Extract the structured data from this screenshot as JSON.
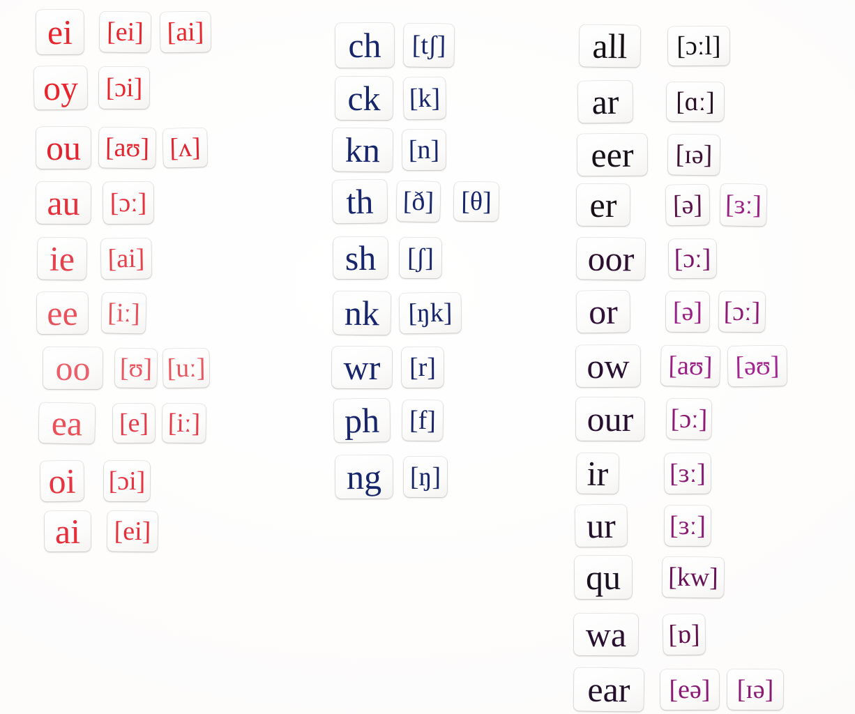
{
  "board": {
    "background_color": "#fdfcfb",
    "tile_color": "#fefefe",
    "description": "Phonics magnet tiles: grapheme spellings paired with IPA phoneme tiles, arranged in three columns"
  },
  "palette": {
    "vowel_red": "#e8242c",
    "vowel_red_light": "#e8555c",
    "vowel_pink": "#ea5a66",
    "consonant_navy": "#17256b",
    "r_controlled_black": "#1b1018",
    "r_controlled_purple": "#5a1048",
    "r_controlled_magenta": "#9b1f84"
  },
  "columns": [
    {
      "name": "vowel-digraphs",
      "rows": [
        {
          "grapheme": "ei",
          "grapheme_color": "#e8242c",
          "phonemes": [
            {
              "text": "[ei]",
              "color": "#e8242c"
            },
            {
              "text": "[ai]",
              "color": "#e8242c"
            }
          ]
        },
        {
          "grapheme": "oy",
          "grapheme_color": "#e8242c",
          "phonemes": [
            {
              "text": "[ɔi]",
              "color": "#e8242c"
            }
          ]
        },
        {
          "grapheme": "ou",
          "grapheme_color": "#e02530",
          "phonemes": [
            {
              "text": "[aʊ]",
              "color": "#e02530"
            },
            {
              "text": "[ʌ]",
              "color": "#e02530"
            }
          ]
        },
        {
          "grapheme": "au",
          "grapheme_color": "#e4313c",
          "phonemes": [
            {
              "text": "[ɔː]",
              "color": "#e4313c"
            }
          ]
        },
        {
          "grapheme": "ie",
          "grapheme_color": "#e5414c",
          "phonemes": [
            {
              "text": "[ai]",
              "color": "#e5414c"
            }
          ]
        },
        {
          "grapheme": "ee",
          "grapheme_color": "#e8525c",
          "phonemes": [
            {
              "text": "[iː]",
              "color": "#e8525c"
            }
          ]
        },
        {
          "grapheme": "oo",
          "grapheme_color": "#ea5f6a",
          "phonemes": [
            {
              "text": "[ʊ]",
              "color": "#e8555f"
            },
            {
              "text": "[uː]",
              "color": "#e8555f"
            }
          ]
        },
        {
          "grapheme": "ea",
          "grapheme_color": "#e8505a",
          "phonemes": [
            {
              "text": "[e]",
              "color": "#e23c48"
            },
            {
              "text": "[iː]",
              "color": "#e23c48"
            }
          ]
        },
        {
          "grapheme": "oi",
          "grapheme_color": "#e63541",
          "phonemes": [
            {
              "text": "[ɔi]",
              "color": "#e63541"
            }
          ]
        },
        {
          "grapheme": "ai",
          "grapheme_color": "#e4303b",
          "phonemes": [
            {
              "text": "[ei]",
              "color": "#e4303b"
            }
          ]
        }
      ]
    },
    {
      "name": "consonant-digraphs",
      "rows": [
        {
          "grapheme": "ch",
          "grapheme_color": "#17256b",
          "phonemes": [
            {
              "text": "[tʃ]",
              "color": "#17256b"
            }
          ]
        },
        {
          "grapheme": "ck",
          "grapheme_color": "#17256b",
          "phonemes": [
            {
              "text": "[k]",
              "color": "#17256b"
            }
          ]
        },
        {
          "grapheme": "kn",
          "grapheme_color": "#17256b",
          "phonemes": [
            {
              "text": "[n]",
              "color": "#17256b"
            }
          ]
        },
        {
          "grapheme": "th",
          "grapheme_color": "#17256b",
          "phonemes": [
            {
              "text": "[ð]",
              "color": "#17256b"
            },
            {
              "text": "[θ]",
              "color": "#17256b"
            }
          ]
        },
        {
          "grapheme": "sh",
          "grapheme_color": "#17256b",
          "phonemes": [
            {
              "text": "[ʃ]",
              "color": "#17256b"
            }
          ]
        },
        {
          "grapheme": "nk",
          "grapheme_color": "#17256b",
          "phonemes": [
            {
              "text": "[ŋk]",
              "color": "#17256b"
            }
          ]
        },
        {
          "grapheme": "wr",
          "grapheme_color": "#17256b",
          "phonemes": [
            {
              "text": "[r]",
              "color": "#17256b"
            }
          ]
        },
        {
          "grapheme": "ph",
          "grapheme_color": "#17256b",
          "phonemes": [
            {
              "text": "[f]",
              "color": "#17256b"
            }
          ]
        },
        {
          "grapheme": "ng",
          "grapheme_color": "#17256b",
          "phonemes": [
            {
              "text": "[ŋ]",
              "color": "#17256b"
            }
          ]
        }
      ]
    },
    {
      "name": "r-controlled-and-other",
      "rows": [
        {
          "grapheme": "all",
          "grapheme_color": "#141014",
          "phonemes": [
            {
              "text": "[ɔːl]",
              "color": "#141014"
            }
          ]
        },
        {
          "grapheme": "ar",
          "grapheme_color": "#15101a",
          "phonemes": [
            {
              "text": "[ɑː]",
              "color": "#2a1024"
            }
          ]
        },
        {
          "grapheme": "eer",
          "grapheme_color": "#171018",
          "phonemes": [
            {
              "text": "[ɪə]",
              "color": "#3e1036"
            }
          ]
        },
        {
          "grapheme": "er",
          "grapheme_color": "#181016",
          "phonemes": [
            {
              "text": "[ə]",
              "color": "#5a1048"
            },
            {
              "text": "[ɜː]",
              "color": "#9b1f84"
            }
          ]
        },
        {
          "grapheme": "oor",
          "grapheme_color": "#2d1030",
          "phonemes": [
            {
              "text": "[ɔː]",
              "color": "#7d1268"
            }
          ]
        },
        {
          "grapheme": "or",
          "grapheme_color": "#33103a",
          "phonemes": [
            {
              "text": "[ə]",
              "color": "#9b1f84"
            },
            {
              "text": "[ɔː]",
              "color": "#8e1a78"
            }
          ]
        },
        {
          "grapheme": "ow",
          "grapheme_color": "#2a1030",
          "phonemes": [
            {
              "text": "[aʊ]",
              "color": "#9b1f84"
            },
            {
              "text": "[əʊ]",
              "color": "#a42490"
            }
          ]
        },
        {
          "grapheme": "our",
          "grapheme_color": "#2a1030",
          "phonemes": [
            {
              "text": "[ɔː]",
              "color": "#8e1a78"
            }
          ]
        },
        {
          "grapheme": "ir",
          "grapheme_color": "#1d1020",
          "phonemes": [
            {
              "text": "[ɜː]",
              "color": "#8a1a74"
            }
          ]
        },
        {
          "grapheme": "ur",
          "grapheme_color": "#22102a",
          "phonemes": [
            {
              "text": "[ɜː]",
              "color": "#8a1a74"
            }
          ]
        },
        {
          "grapheme": "qu",
          "grapheme_color": "#1a1020",
          "phonemes": [
            {
              "text": "[kw]",
              "color": "#6a1258"
            }
          ]
        },
        {
          "grapheme": "wa",
          "grapheme_color": "#2a1030",
          "phonemes": [
            {
              "text": "[ɒ]",
              "color": "#62104e"
            }
          ]
        },
        {
          "grapheme": "ear",
          "grapheme_color": "#22102a",
          "phonemes": [
            {
              "text": "[eə]",
              "color": "#8a1a74"
            },
            {
              "text": "[ɪə]",
              "color": "#8a1a74"
            }
          ]
        }
      ]
    }
  ]
}
